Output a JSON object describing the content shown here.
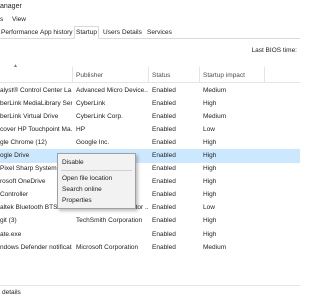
{
  "window": {
    "title": "anager"
  },
  "menu": {
    "items": [
      "s",
      "View"
    ]
  },
  "tabs": [
    {
      "label": "Performance",
      "active": false
    },
    {
      "label": "App history",
      "active": false
    },
    {
      "label": "Startup",
      "active": true
    },
    {
      "label": "Users",
      "active": false
    },
    {
      "label": "Details",
      "active": false
    },
    {
      "label": "Services",
      "active": false
    }
  ],
  "last_bios": "Last BIOS time:",
  "columns": {
    "publisher": "Publisher",
    "status": "Status",
    "impact": "Startup impact"
  },
  "rows": [
    {
      "name": "alyst® Control Center La...",
      "publisher": "Advanced Micro Device...",
      "status": "Enabled",
      "impact": "Medium"
    },
    {
      "name": "berLink MediaLibrary Serv...",
      "publisher": "CyberLink",
      "status": "Enabled",
      "impact": "High"
    },
    {
      "name": "berLink Virtual Drive",
      "publisher": "CyberLink Corp.",
      "status": "Enabled",
      "impact": "Medium"
    },
    {
      "name": "cover HP Touchpoint Ma...",
      "publisher": "HP",
      "status": "Enabled",
      "impact": "Low"
    },
    {
      "name": "gle Chrome (12)",
      "publisher": "Google Inc.",
      "status": "Enabled",
      "impact": "High"
    },
    {
      "name": "ogle Drive",
      "publisher": "",
      "status": "Enabled",
      "impact": "High"
    },
    {
      "name": "Pixel Sharp System",
      "publisher": "",
      "status": "Enabled",
      "impact": "High"
    },
    {
      "name": "rosoft OneDrive",
      "publisher": "",
      "status": "Enabled",
      "impact": "High"
    },
    {
      "name": "Controller",
      "publisher": "",
      "status": "Enabled",
      "impact": "High"
    },
    {
      "name": "altek Bluetooth BTServer ...",
      "publisher": "Realtek Semiconductor ...",
      "status": "Enabled",
      "impact": "Low"
    },
    {
      "name": "git (3)",
      "publisher": "TechSmith Corporation",
      "status": "Enabled",
      "impact": "High"
    },
    {
      "name": "ate.exe",
      "publisher": "",
      "status": "Enabled",
      "impact": "High"
    },
    {
      "name": "ndows Defender notificati...",
      "publisher": "Microsoft Corporation",
      "status": "Enabled",
      "impact": "Medium"
    }
  ],
  "selected_row": 5,
  "context_menu": {
    "items": [
      "Disable",
      "Open file location",
      "Search online",
      "Properties"
    ]
  },
  "footer": {
    "details": "details"
  },
  "colors": {
    "selection": "#cce8ff",
    "accent": "#2a6fb5"
  }
}
